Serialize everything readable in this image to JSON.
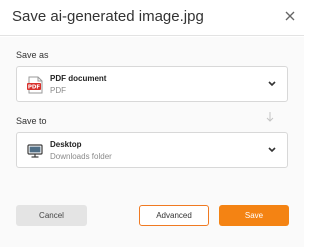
{
  "dialog": {
    "title": "Save ai-generated image.jpg",
    "close_icon": "close-icon"
  },
  "save_as": {
    "label": "Save as",
    "selected_main": "PDF document",
    "selected_sub": "PDF",
    "icon": "pdf-file-icon"
  },
  "save_to": {
    "label": "Save to",
    "selected_main": "Desktop",
    "selected_sub": "Downloads folder",
    "icon": "monitor-icon"
  },
  "buttons": {
    "cancel": "Cancel",
    "advanced": "Advanced",
    "save": "Save"
  },
  "colors": {
    "accent": "#f48313",
    "pdf_red": "#d8302c"
  }
}
